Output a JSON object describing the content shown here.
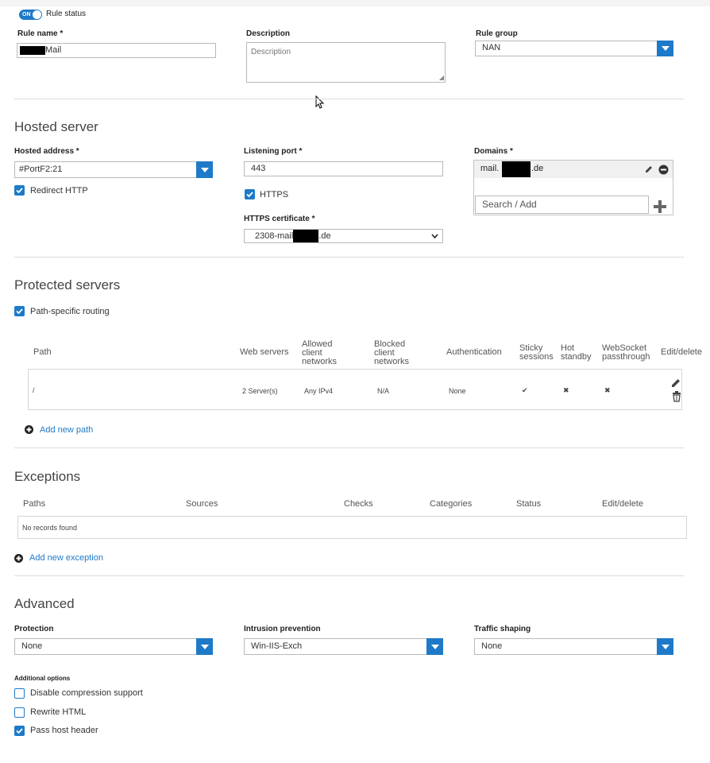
{
  "rule_status": {
    "toggle": "ON",
    "label": "Rule status"
  },
  "rule_name": {
    "label": "Rule name *",
    "value": "Mail"
  },
  "description": {
    "label": "Description",
    "placeholder": "Description"
  },
  "rule_group": {
    "label": "Rule group",
    "value": "NAN"
  },
  "hosted_server": {
    "title": "Hosted server",
    "address_label": "Hosted address *",
    "address_value": "#PortF2:21",
    "redirect_http": "Redirect HTTP",
    "port_label": "Listening port *",
    "port_value": "443",
    "https": "HTTPS",
    "cert_label": "HTTPS certificate *",
    "cert_prefix": "2308-mail",
    "cert_suffix": ".de",
    "domains_label": "Domains *",
    "domain_prefix": "mail.",
    "domain_suffix": ".de",
    "search_placeholder": "Search / Add"
  },
  "protected_servers": {
    "title": "Protected servers",
    "path_routing": "Path-specific routing",
    "headers": {
      "path": "Path",
      "web_servers": "Web servers",
      "allowed": "Allowed client networks",
      "blocked": "Blocked client networks",
      "auth": "Authentication",
      "sticky": "Sticky sessions",
      "hot": "Hot standby",
      "websocket": "WebSocket passthrough",
      "edit": "Edit/delete"
    },
    "row": {
      "path": "/",
      "web_servers": "2 Server(s)",
      "allowed": "Any IPv4",
      "blocked": "N/A",
      "auth": "None",
      "sticky": "✔",
      "hot": "✖",
      "websocket": "✖"
    },
    "add_path": "Add new path"
  },
  "exceptions": {
    "title": "Exceptions",
    "headers": {
      "paths": "Paths",
      "sources": "Sources",
      "checks": "Checks",
      "categories": "Categories",
      "status": "Status",
      "edit": "Edit/delete"
    },
    "empty": "No records found",
    "add": "Add new exception"
  },
  "advanced": {
    "title": "Advanced",
    "protection_label": "Protection",
    "protection_value": "None",
    "ips_label": "Intrusion prevention",
    "ips_value": "Win-IIS-Exch",
    "traffic_label": "Traffic shaping",
    "traffic_value": "None",
    "additional_label": "Additional options",
    "opt_compression": "Disable compression support",
    "opt_rewrite": "Rewrite HTML",
    "opt_host_header": "Pass host header"
  },
  "colors": {
    "accent": "#1e7ac8"
  }
}
